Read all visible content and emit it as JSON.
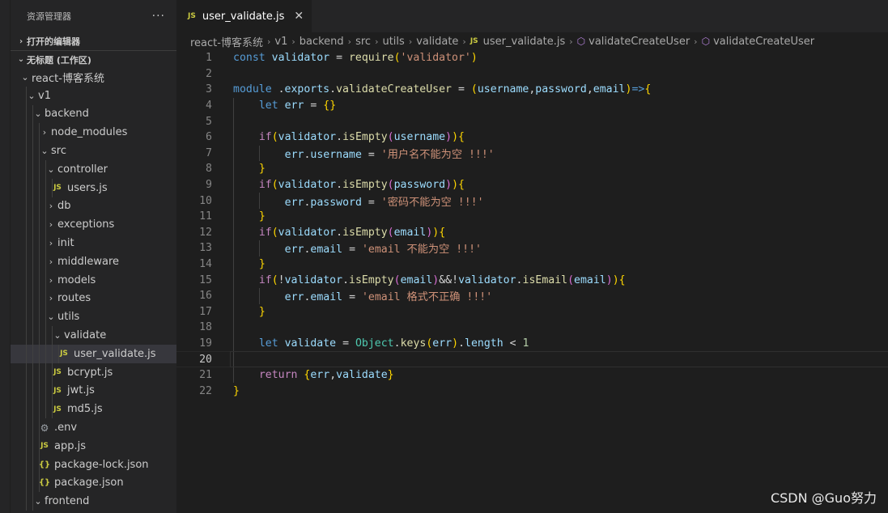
{
  "sidebar": {
    "title": "资源管理器",
    "more_icon": "ellipsis-icon",
    "open_editors": "打开的编辑器",
    "workspace": "无标题 (工作区)",
    "tree": [
      {
        "label": "react-博客系统",
        "type": "folder",
        "open": true,
        "depth": 0
      },
      {
        "label": "v1",
        "type": "folder",
        "open": true,
        "depth": 1
      },
      {
        "label": "backend",
        "type": "folder",
        "open": true,
        "depth": 2
      },
      {
        "label": "node_modules",
        "type": "folder",
        "open": false,
        "depth": 3
      },
      {
        "label": "src",
        "type": "folder",
        "open": true,
        "depth": 3
      },
      {
        "label": "controller",
        "type": "folder",
        "open": true,
        "depth": 4
      },
      {
        "label": "users.js",
        "type": "js",
        "depth": 5
      },
      {
        "label": "db",
        "type": "folder",
        "open": false,
        "depth": 4
      },
      {
        "label": "exceptions",
        "type": "folder",
        "open": false,
        "depth": 4
      },
      {
        "label": "init",
        "type": "folder",
        "open": false,
        "depth": 4
      },
      {
        "label": "middleware",
        "type": "folder",
        "open": false,
        "depth": 4
      },
      {
        "label": "models",
        "type": "folder",
        "open": false,
        "depth": 4
      },
      {
        "label": "routes",
        "type": "folder",
        "open": false,
        "depth": 4
      },
      {
        "label": "utils",
        "type": "folder",
        "open": true,
        "depth": 4
      },
      {
        "label": "validate",
        "type": "folder",
        "open": true,
        "depth": 5
      },
      {
        "label": "user_validate.js",
        "type": "js",
        "depth": 6,
        "selected": true
      },
      {
        "label": "bcrypt.js",
        "type": "js",
        "depth": 5
      },
      {
        "label": "jwt.js",
        "type": "js",
        "depth": 5
      },
      {
        "label": "md5.js",
        "type": "js",
        "depth": 5
      },
      {
        "label": ".env",
        "type": "env",
        "depth": 3
      },
      {
        "label": "app.js",
        "type": "js",
        "depth": 3
      },
      {
        "label": "package-lock.json",
        "type": "json",
        "depth": 3
      },
      {
        "label": "package.json",
        "type": "json",
        "depth": 3
      },
      {
        "label": "frontend",
        "type": "folder",
        "open": true,
        "depth": 2
      }
    ]
  },
  "tab": {
    "icon_label": "JS",
    "filename": "user_validate.js",
    "close_icon": "close-icon"
  },
  "breadcrumb": [
    "react-博客系统",
    "v1",
    "backend",
    "src",
    "utils",
    "validate",
    "user_validate.js",
    "validateCreateUser",
    "validateCreateUser"
  ],
  "editor": {
    "current_line": 20,
    "lines": [
      {
        "n": "1"
      },
      {
        "n": "2"
      },
      {
        "n": "3"
      },
      {
        "n": "4"
      },
      {
        "n": "5"
      },
      {
        "n": "6"
      },
      {
        "n": "7"
      },
      {
        "n": "8"
      },
      {
        "n": "9"
      },
      {
        "n": "10"
      },
      {
        "n": "11"
      },
      {
        "n": "12"
      },
      {
        "n": "13"
      },
      {
        "n": "14"
      },
      {
        "n": "15"
      },
      {
        "n": "16"
      },
      {
        "n": "17"
      },
      {
        "n": "18"
      },
      {
        "n": "19"
      },
      {
        "n": "20"
      },
      {
        "n": "21"
      },
      {
        "n": "22"
      }
    ],
    "code": [
      "const validator = require('validator')",
      "",
      "module .exports.validateCreateUser = (username,password,email)=>{",
      "    let err = {}",
      "",
      "    if(validator.isEmpty(username)){",
      "        err.username = '用户名不能为空 !!!'",
      "    }",
      "    if(validator.isEmpty(password)){",
      "        err.password = '密码不能为空 !!!'",
      "    }",
      "    if(validator.isEmpty(email)){",
      "        err.email = 'email 不能为空 !!!'",
      "    }",
      "    if(!validator.isEmpty(email)&&!validator.isEmail(email)){",
      "        err.email = 'email 格式不正确 !!!'",
      "    }",
      "",
      "    let validate = Object.keys(err).length < 1",
      "",
      "    return {err,validate}",
      "}"
    ]
  },
  "watermark": "CSDN @Guo努力"
}
